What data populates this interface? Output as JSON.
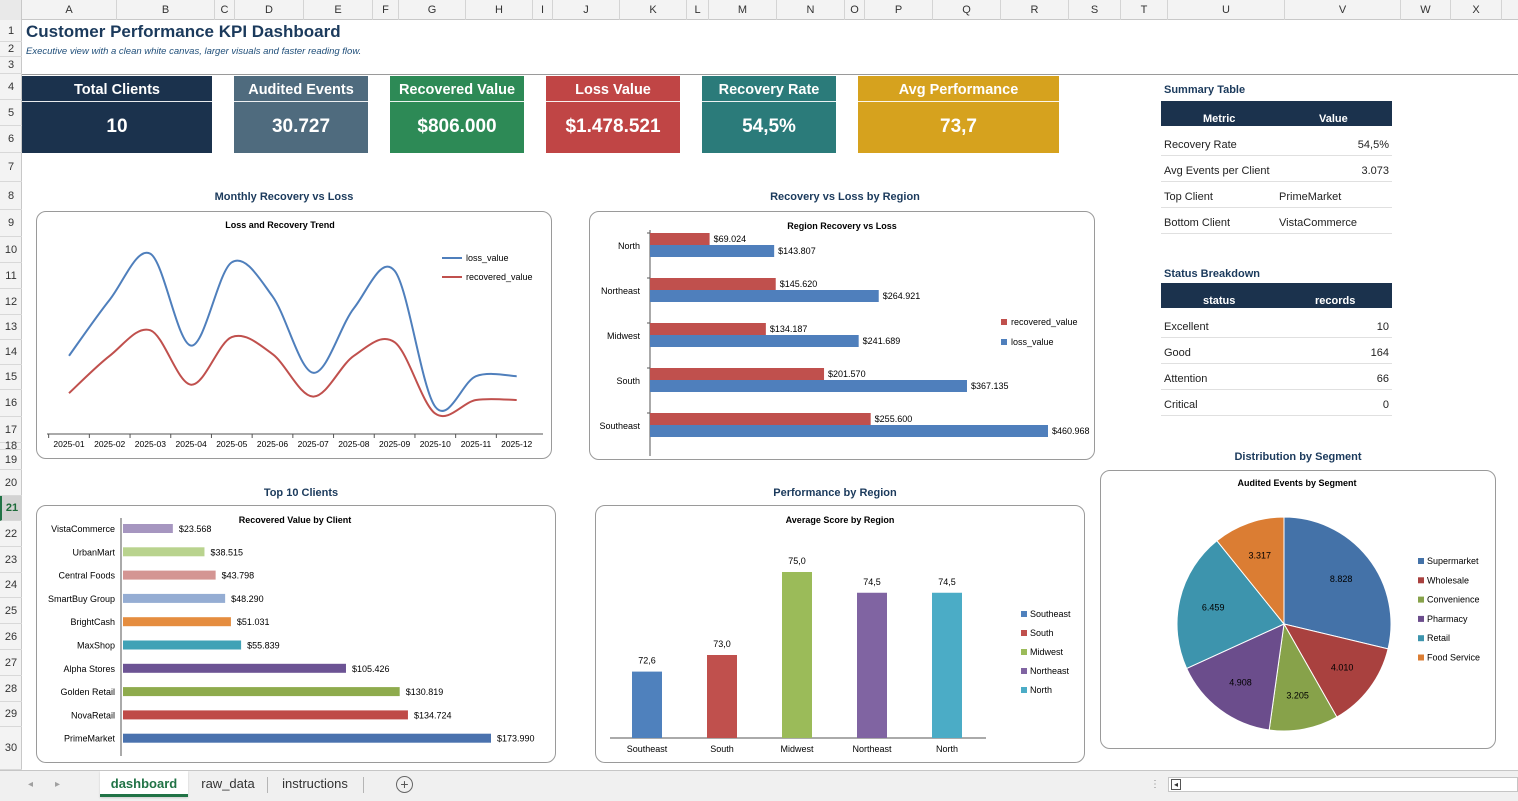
{
  "sheet": {
    "columns": [
      "A",
      "B",
      "C",
      "D",
      "E",
      "F",
      "G",
      "H",
      "I",
      "J",
      "K",
      "L",
      "M",
      "N",
      "O",
      "P",
      "Q",
      "R",
      "S",
      "T",
      "U",
      "V",
      "W",
      "X"
    ],
    "rows": [
      "1",
      "2",
      "3",
      "4",
      "5",
      "6",
      "7",
      "8",
      "9",
      "10",
      "11",
      "12",
      "13",
      "14",
      "15",
      "16",
      "17",
      "18",
      "19",
      "20",
      "21",
      "22",
      "23",
      "24",
      "25",
      "26",
      "27",
      "28",
      "29",
      "30"
    ],
    "active_row": "21"
  },
  "header": {
    "title": "Customer Performance KPI Dashboard",
    "subtitle": "Executive view with a clean white canvas, larger visuals and faster reading flow."
  },
  "kpis": [
    {
      "label": "Total Clients",
      "value": "10",
      "color": "#1b324d"
    },
    {
      "label": "Audited Events",
      "value": "30.727",
      "color": "#4f6b7e"
    },
    {
      "label": "Recovered Value",
      "value": "$806.000",
      "color": "#2d8a56"
    },
    {
      "label": "Loss Value",
      "value": "$1.478.521",
      "color": "#c04545"
    },
    {
      "label": "Recovery Rate",
      "value": "54,5%",
      "color": "#2b7b7a"
    },
    {
      "label": "Avg Performance",
      "value": "73,7",
      "color": "#d6a21e"
    }
  ],
  "summary_table": {
    "title": "Summary Table",
    "headers": [
      "Metric",
      "Value"
    ],
    "rows": [
      {
        "metric": "Recovery Rate",
        "value": "54,5%"
      },
      {
        "metric": "Avg Events per Client",
        "value": "3.073"
      },
      {
        "metric": "Top Client",
        "value": "PrimeMarket"
      },
      {
        "metric": "Bottom Client",
        "value": "VistaCommerce"
      }
    ]
  },
  "status_table": {
    "title": "Status Breakdown",
    "headers": [
      "status",
      "records"
    ],
    "rows": [
      {
        "status": "Excellent",
        "records": "10"
      },
      {
        "status": "Good",
        "records": "164"
      },
      {
        "status": "Attention",
        "records": "66"
      },
      {
        "status": "Critical",
        "records": "0"
      }
    ]
  },
  "sections": {
    "monthly": "Monthly Recovery vs Loss",
    "region": "Recovery vs Loss by Region",
    "top10": "Top 10 Clients",
    "performance": "Performance by Region",
    "distribution": "Distribution by Segment"
  },
  "colors": {
    "loss": "#4f7fbc",
    "recovered": "#c0504d"
  },
  "chart_data": [
    {
      "id": "trend",
      "type": "line",
      "title": "Loss and Recovery Trend",
      "x": [
        "2025-01",
        "2025-02",
        "2025-03",
        "2025-04",
        "2025-05",
        "2025-06",
        "2025-07",
        "2025-08",
        "2025-09",
        "2025-10",
        "2025-11",
        "2025-12"
      ],
      "series": [
        {
          "name": "loss_value",
          "values": [
            92,
            158,
            212,
            104,
            202,
            162,
            72,
            148,
            192,
            32,
            68,
            68
          ],
          "color": "#4f7fbc"
        },
        {
          "name": "recovered_value",
          "values": [
            48,
            92,
            122,
            58,
            114,
            94,
            44,
            92,
            108,
            24,
            40,
            40
          ],
          "color": "#c0504d"
        }
      ],
      "ylim": [
        0,
        240
      ]
    },
    {
      "id": "region",
      "type": "bar",
      "orientation": "horizontal",
      "title": "Region Recovery vs Loss",
      "categories": [
        "North",
        "Northeast",
        "Midwest",
        "South",
        "Southeast"
      ],
      "series": [
        {
          "name": "recovered_value",
          "values": [
            69024,
            145620,
            134187,
            201570,
            255600
          ],
          "labels": [
            "$69.024",
            "$145.620",
            "$134.187",
            "$201.570",
            "$255.600"
          ],
          "color": "#c0504d"
        },
        {
          "name": "loss_value",
          "values": [
            143807,
            264921,
            241689,
            367135,
            460968
          ],
          "labels": [
            "$143.807",
            "$264.921",
            "$241.689",
            "$367.135",
            "$460.968"
          ],
          "color": "#4f7fbc"
        }
      ],
      "xlim": [
        0,
        460968
      ]
    },
    {
      "id": "top10",
      "type": "bar",
      "orientation": "horizontal",
      "title": "Recovered Value by Client",
      "categories": [
        "VistaCommerce",
        "UrbanMart",
        "Central Foods",
        "SmartBuy Group",
        "BrightCash",
        "MaxShop",
        "Alpha Stores",
        "Golden Retail",
        "NovaRetail",
        "PrimeMarket"
      ],
      "values": [
        23568,
        38515,
        43798,
        48290,
        51031,
        55839,
        105426,
        130819,
        134724,
        173990
      ],
      "labels": [
        "$23.568",
        "$38.515",
        "$43.798",
        "$48.290",
        "$51.031",
        "$55.839",
        "$105.426",
        "$130.819",
        "$134.724",
        "$173.990"
      ],
      "colors": [
        "#a696c0",
        "#b9d38e",
        "#d49593",
        "#95add3",
        "#e58d3f",
        "#41a2b6",
        "#6c5394",
        "#8eab4d",
        "#bf4b48",
        "#4a72ae"
      ],
      "xlim": [
        0,
        173990
      ]
    },
    {
      "id": "performance",
      "type": "bar",
      "title": "Average Score by Region",
      "categories": [
        "Southeast",
        "South",
        "Midwest",
        "Northeast",
        "North"
      ],
      "values": [
        72.6,
        73.0,
        75.0,
        74.5,
        74.5
      ],
      "labels": [
        "72,6",
        "73,0",
        "75,0",
        "74,5",
        "74,5"
      ],
      "colors": [
        "#4f81bd",
        "#c0504d",
        "#9bbb59",
        "#8064a2",
        "#4bacc6"
      ],
      "legend": [
        "Southeast",
        "South",
        "Midwest",
        "Northeast",
        "North"
      ],
      "ylim": [
        71.0,
        75.0
      ]
    },
    {
      "id": "segment",
      "type": "pie",
      "title": "Audited Events by Segment",
      "categories": [
        "Supermarket",
        "Wholesale",
        "Convenience",
        "Pharmacy",
        "Retail",
        "Food Service"
      ],
      "values": [
        8828,
        4010,
        3205,
        4908,
        6459,
        3317
      ],
      "labels": [
        "8.828",
        "4.010",
        "3.205",
        "4.908",
        "6.459",
        "3.317"
      ],
      "colors": [
        "#4472a8",
        "#a9413f",
        "#87a24a",
        "#6b4d8c",
        "#3d94ad",
        "#db7d33"
      ]
    }
  ],
  "tabs": {
    "sheets": [
      {
        "label": "dashboard",
        "active": true
      },
      {
        "label": "raw_data",
        "active": false
      },
      {
        "label": "instructions",
        "active": false
      }
    ],
    "add_label": "+",
    "prev_arrow": "◂",
    "next_arrow": "▸",
    "scroll_left": "◂",
    "scroll_dots": "⋮"
  }
}
